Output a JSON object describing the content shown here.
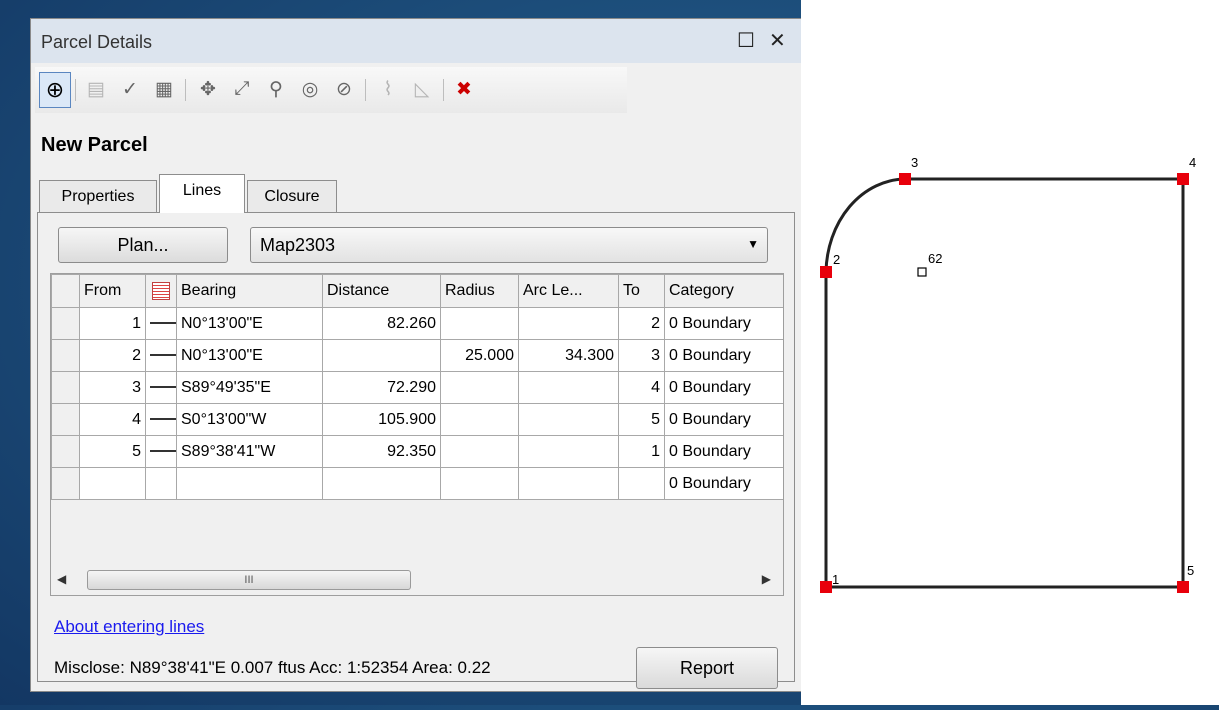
{
  "window": {
    "title": "Parcel Details"
  },
  "toolbar": {
    "tools": [
      {
        "icon": "crosshair-icon",
        "glyph": "⊕"
      },
      {
        "icon": "new-parcel-icon",
        "glyph": "▤"
      },
      {
        "icon": "check-parcel-icon",
        "glyph": "✓"
      },
      {
        "icon": "parcel-grid-icon",
        "glyph": "▦"
      },
      {
        "icon": "join-points-icon",
        "glyph": "✥"
      },
      {
        "icon": "draw-line-icon",
        "glyph": "⤢"
      },
      {
        "icon": "point-line-icon",
        "glyph": "⚲"
      },
      {
        "icon": "circle-point-icon",
        "glyph": "◎"
      },
      {
        "icon": "circle-edit-icon",
        "glyph": "⊘"
      },
      {
        "icon": "compute-icon",
        "glyph": "⌇"
      },
      {
        "icon": "shape-icon",
        "glyph": "◺"
      },
      {
        "icon": "delete-parcel-icon",
        "glyph": "✖"
      }
    ]
  },
  "parcel": {
    "name": "New Parcel"
  },
  "tabs": [
    {
      "label": "Properties"
    },
    {
      "label": "Lines"
    },
    {
      "label": "Closure"
    }
  ],
  "lines_tab": {
    "plan_button": "Plan...",
    "plan_value": "Map2303",
    "columns": [
      "From",
      "",
      "Bearing",
      "Distance",
      "Radius",
      "Arc Le...",
      "To",
      "Category"
    ],
    "rows": [
      {
        "from": "1",
        "bearing": "N0°13'00\"E",
        "distance": "82.260",
        "radius": "",
        "arc": "",
        "to": "2",
        "category": "0 Boundary"
      },
      {
        "from": "2",
        "bearing": "N0°13'00\"E",
        "distance": "",
        "radius": "25.000",
        "arc": "34.300",
        "to": "3",
        "category": "0 Boundary"
      },
      {
        "from": "3",
        "bearing": "S89°49'35\"E",
        "distance": "72.290",
        "radius": "",
        "arc": "",
        "to": "4",
        "category": "0 Boundary"
      },
      {
        "from": "4",
        "bearing": "S0°13'00\"W",
        "distance": "105.900",
        "radius": "",
        "arc": "",
        "to": "5",
        "category": "0 Boundary"
      },
      {
        "from": "5",
        "bearing": "S89°38'41\"W",
        "distance": "92.350",
        "radius": "",
        "arc": "",
        "to": "1",
        "category": "0 Boundary"
      },
      {
        "from": "",
        "bearing": "",
        "distance": "",
        "radius": "",
        "arc": "",
        "to": "",
        "category": "0 Boundary"
      }
    ],
    "scroll_thumb_mark": "III",
    "about_link": "About entering lines",
    "status": "Misclose: N89°38'41\"E 0.007 ftus  Acc: 1:52354  Area: 0.22",
    "report_button": "Report"
  },
  "canvas": {
    "points": [
      {
        "id": "1",
        "label": "1"
      },
      {
        "id": "2",
        "label": "2"
      },
      {
        "id": "3",
        "label": "3"
      },
      {
        "id": "4",
        "label": "4"
      },
      {
        "id": "5",
        "label": "5"
      }
    ],
    "center_label": "62",
    "line_color": "#222222",
    "point_color": "#e8000b"
  }
}
